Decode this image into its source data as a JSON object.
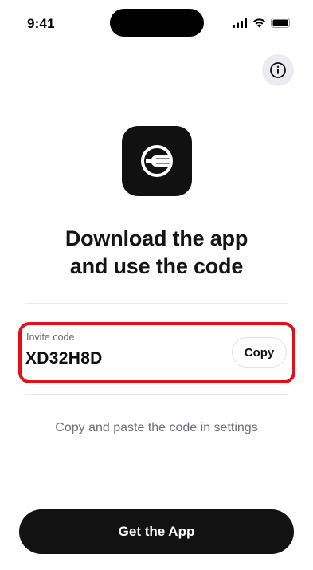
{
  "status_bar": {
    "time": "9:41",
    "icons": [
      "cellular-signal-icon",
      "wifi-icon",
      "battery-icon"
    ]
  },
  "header": {
    "info_icon": "info-icon"
  },
  "app": {
    "logo_icon": "worldcoin-logo-icon"
  },
  "main": {
    "headline_line1": "Download the app",
    "headline_line2": "and use the code",
    "invite": {
      "label": "Invite code",
      "code": "XD32H8D",
      "copy_label": "Copy"
    },
    "instruction": "Copy and paste the code in settings"
  },
  "footer": {
    "cta_label": "Get the App"
  },
  "colors": {
    "highlight": "#e3101a",
    "button_dark": "#121212",
    "muted_text": "#6e6e76"
  }
}
